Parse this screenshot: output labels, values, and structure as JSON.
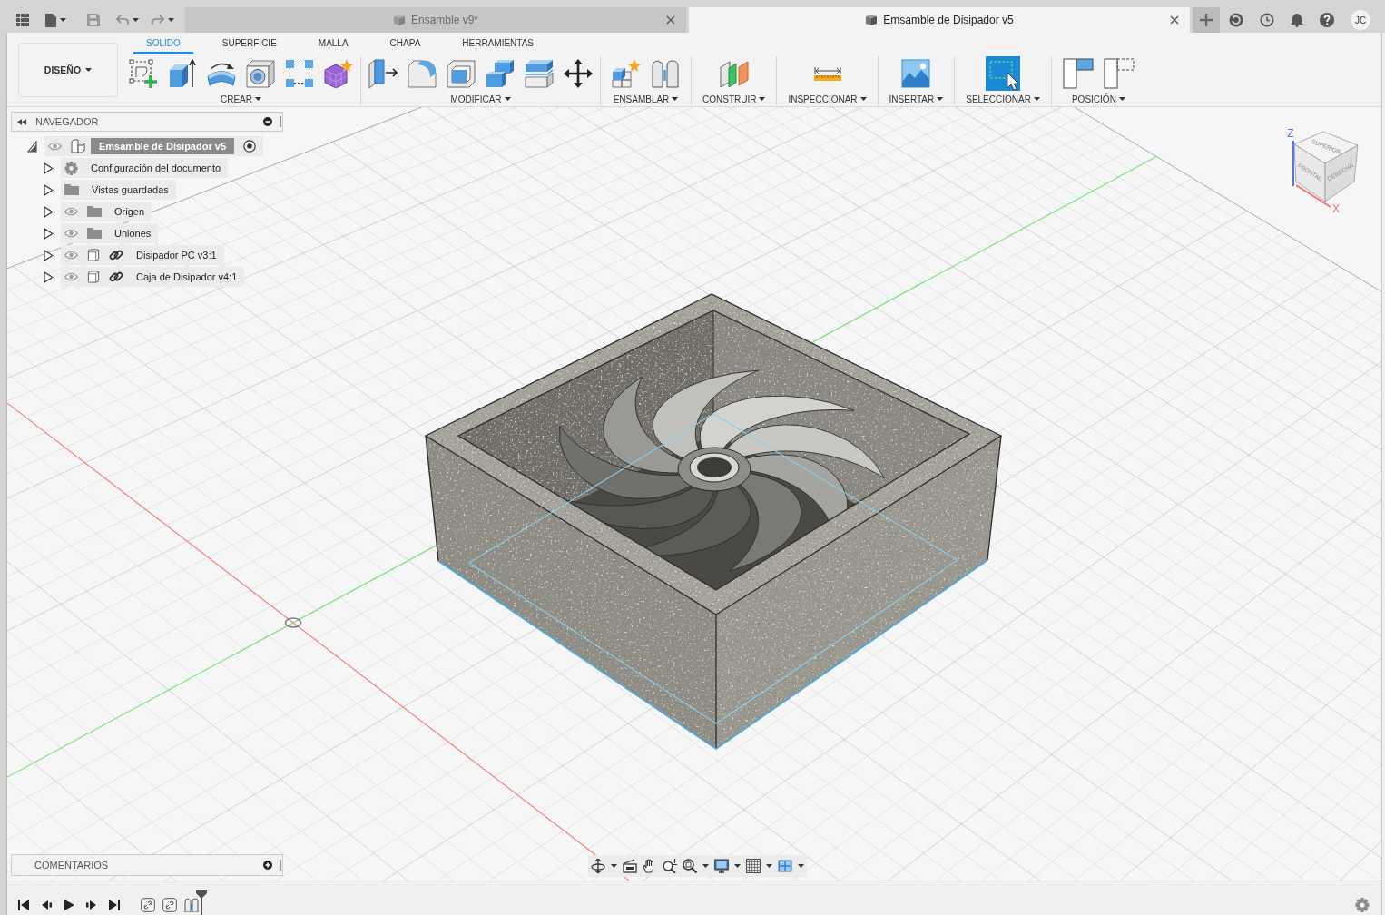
{
  "window": {
    "tabs": [
      {
        "title": "Ensamble v9*",
        "selected": false
      },
      {
        "title": "Emsamble de Disipador v5",
        "selected": true
      }
    ],
    "user_initials": "JC"
  },
  "toolbar": {
    "workspace": "DISEÑO",
    "tabs": [
      {
        "label": "SOLIDO",
        "selected": true
      },
      {
        "label": "SUPERFICIE",
        "selected": false
      },
      {
        "label": "MALLA",
        "selected": false
      },
      {
        "label": "CHAPA",
        "selected": false
      },
      {
        "label": "HERRAMIENTAS",
        "selected": false
      }
    ],
    "groups": [
      {
        "label": "CREAR"
      },
      {
        "label": "MODIFICAR"
      },
      {
        "label": "ENSAMBLAR"
      },
      {
        "label": "CONSTRUIR"
      },
      {
        "label": "INSPECCIONAR"
      },
      {
        "label": "INSERTAR"
      },
      {
        "label": "SELECCIONAR"
      },
      {
        "label": "POSICIÓN"
      }
    ]
  },
  "navigator": {
    "title": "NAVEGADOR",
    "tree": [
      {
        "label": "Emsamble de Disipador v5",
        "kind": "assembly",
        "active": true,
        "expanded": true,
        "children": [
          {
            "label": "Configuración del documento",
            "kind": "settings",
            "active": false,
            "expanded": false
          },
          {
            "label": "Vistas guardadas",
            "kind": "views",
            "active": false,
            "expanded": false
          },
          {
            "label": "Origen",
            "kind": "folder",
            "active": false,
            "expanded": false
          },
          {
            "label": "Uniones",
            "kind": "folder",
            "active": false,
            "expanded": false
          },
          {
            "label": "Disipador PC v3:1",
            "kind": "link",
            "active": false,
            "expanded": false
          },
          {
            "label": "Caja de Disipador v4:1",
            "kind": "link",
            "active": false,
            "expanded": false
          }
        ]
      }
    ]
  },
  "view_cube": {
    "top": "SUPERIOR",
    "front": "FRONTAL",
    "right": "DERECHA",
    "z_axis": "Z",
    "x_axis": "X"
  },
  "comments": {
    "title": "COMENTARIOS"
  }
}
